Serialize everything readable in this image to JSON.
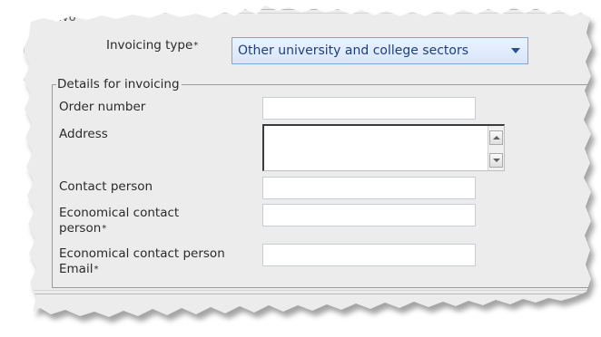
{
  "section": {
    "legend_fragment": "Invo"
  },
  "invoicing_type": {
    "label": "Invoicing type",
    "required_mark": "*",
    "selected_value": "Other university and college sectors"
  },
  "details": {
    "legend": "Details for invoicing",
    "order_number": {
      "label": "Order number",
      "value": ""
    },
    "address": {
      "label": "Address",
      "value": ""
    },
    "contact_person": {
      "label": "Contact person",
      "value": ""
    },
    "economical_contact_person": {
      "label_line1": "Economical contact",
      "label_line2": "person",
      "required_mark": "*",
      "value": ""
    },
    "economical_contact_email": {
      "label_line1": "Economical contact person",
      "label_line2": "Email",
      "required_mark": "*",
      "value": ""
    }
  },
  "colors": {
    "dropdown_text": "#1f3f7a",
    "dropdown_border": "#7fa4d8",
    "panel_background": "#ececec"
  }
}
